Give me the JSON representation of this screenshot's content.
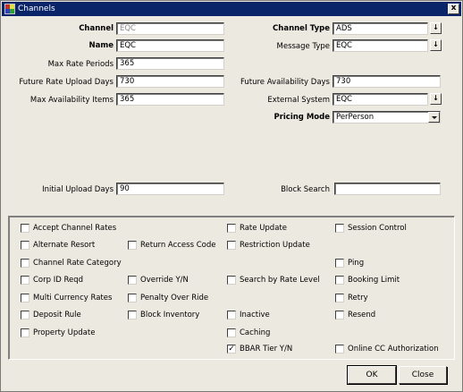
{
  "window": {
    "title": "Channels",
    "close_glyph": "x"
  },
  "form": {
    "channel": {
      "label": "Channel",
      "value": "EQC"
    },
    "name": {
      "label": "Name",
      "value": "EQC"
    },
    "max_rate_periods": {
      "label": "Max Rate Periods",
      "value": "365"
    },
    "future_rate_upload_days": {
      "label": "Future Rate Upload Days",
      "value": "730"
    },
    "max_availability_items": {
      "label": "Max Availability Items",
      "value": "365"
    },
    "channel_type": {
      "label": "Channel Type",
      "value": "ADS"
    },
    "message_type": {
      "label": "Message Type",
      "value": "EQC"
    },
    "future_availability_days": {
      "label": "Future Availability Days",
      "value": "730"
    },
    "external_system": {
      "label": "External System",
      "value": "EQC"
    },
    "pricing_mode": {
      "label": "Pricing Mode",
      "value": "PerPerson"
    },
    "initial_upload_days": {
      "label": "Initial Upload Days",
      "value": "90"
    },
    "block_search": {
      "label": "Block Search",
      "value": ""
    },
    "lov_glyph": "↓"
  },
  "checkboxes": [
    {
      "label": "Accept Channel Rates",
      "checked": false
    },
    {
      "label": "Rate Update",
      "checked": false
    },
    {
      "label": "Session Control",
      "checked": false
    },
    {
      "label": "Alternate Resort",
      "checked": false
    },
    {
      "label": "Return Access Code",
      "checked": false
    },
    {
      "label": "Restriction Update",
      "checked": false
    },
    {
      "label": "Channel Rate Category",
      "checked": false
    },
    {
      "label": "Ping",
      "checked": false
    },
    {
      "label": "Corp ID Reqd",
      "checked": false
    },
    {
      "label": "Override Y/N",
      "checked": false
    },
    {
      "label": "Search by Rate Level",
      "checked": false
    },
    {
      "label": "Booking Limit",
      "checked": false
    },
    {
      "label": "Multi Currency Rates",
      "checked": false
    },
    {
      "label": "Penalty Over Ride",
      "checked": false
    },
    {
      "label": "Retry",
      "checked": false
    },
    {
      "label": "Deposit Rule",
      "checked": false
    },
    {
      "label": "Block Inventory",
      "checked": false
    },
    {
      "label": "Inactive",
      "checked": false
    },
    {
      "label": "Resend",
      "checked": false
    },
    {
      "label": "Property Update",
      "checked": false
    },
    {
      "label": "Caching",
      "checked": false
    },
    {
      "label": "BBAR Tier Y/N",
      "checked": true
    },
    {
      "label": "Online CC Authorization",
      "checked": false
    }
  ],
  "buttons": {
    "ok": "OK",
    "close": "Close"
  },
  "check_glyph": "✓",
  "colors": {
    "titlebar": "#0a246a",
    "window_bg": "#ece9e1",
    "readonly_text": "#8a8a8a"
  }
}
